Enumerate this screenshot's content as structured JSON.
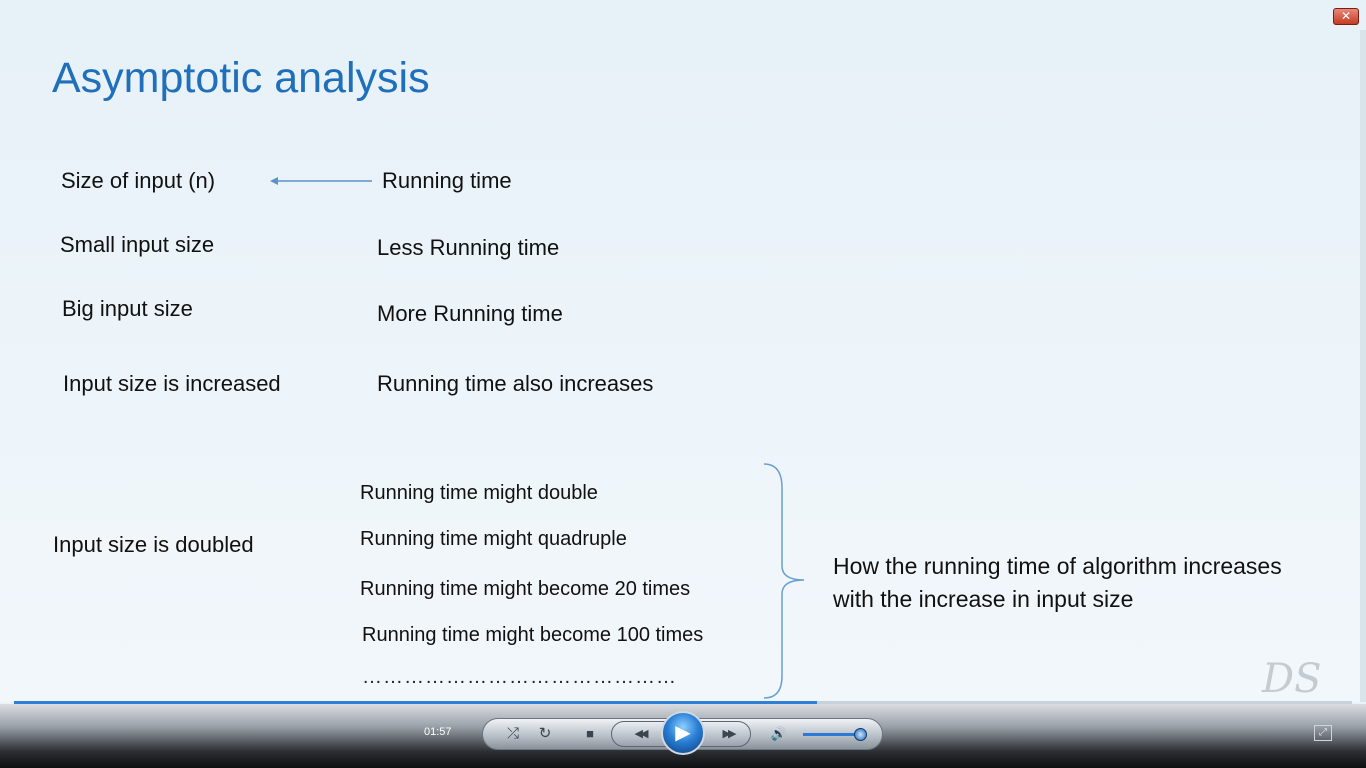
{
  "slide": {
    "title": "Asymptotic analysis",
    "rows": [
      {
        "left": "Size of input (n)",
        "right": "Running time"
      },
      {
        "left": "Small input size",
        "right": "Less Running time"
      },
      {
        "left": "Big input size",
        "right": "More Running time"
      },
      {
        "left": "Input size is increased",
        "right": "Running time also increases"
      }
    ],
    "doubled_label": "Input size is doubled",
    "possibilities": [
      "Running time might double",
      "Running time might quadruple",
      "Running time might become 20 times",
      "Running time might become 100 times"
    ],
    "dots": "………………………………………",
    "summary_line1": "How the running time of algorithm increases",
    "summary_line2": "with the increase in input size",
    "watermark": "DS"
  },
  "window": {
    "close_glyph": "✕"
  },
  "player": {
    "elapsed": "01:57",
    "progress": 0.6,
    "volume": 0.9,
    "icons": {
      "shuffle": "⤮",
      "repeat": "↻",
      "stop": "■",
      "rewind": "◀◀",
      "play": "▶",
      "forward": "▶▶",
      "volume": "🔊",
      "mini": "⤢"
    },
    "colors": {
      "accent": "#2f7fd6",
      "title": "#1f6fba"
    }
  }
}
